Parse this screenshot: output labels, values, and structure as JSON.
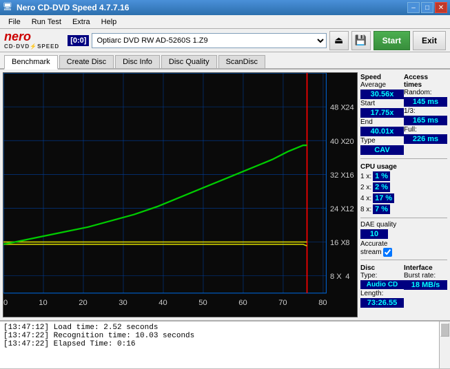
{
  "titlebar": {
    "icon": "●",
    "title": "Nero CD-DVD Speed 4.7.7.16",
    "minimize": "–",
    "maximize": "□",
    "close": "✕"
  },
  "menu": {
    "items": [
      "File",
      "Run Test",
      "Extra",
      "Help"
    ]
  },
  "toolbar": {
    "logo_nero": "nero",
    "logo_sub": "CD·DVD/SPEED",
    "drive_label": "[0:0]",
    "drive_value": "Optiarc DVD RW AD-5260S 1.Z9",
    "start_label": "Start",
    "exit_label": "Exit"
  },
  "tabs": {
    "items": [
      "Benchmark",
      "Create Disc",
      "Disc Info",
      "Disc Quality",
      "ScanDisc"
    ],
    "active": "Benchmark"
  },
  "stats": {
    "speed_label": "Speed",
    "average_label": "Average",
    "average_value": "30.56x",
    "start_label": "Start",
    "start_value": "17.75x",
    "end_label": "End",
    "end_value": "40.01x",
    "type_label": "Type",
    "type_value": "CAV",
    "access_times_label": "Access times",
    "random_label": "Random:",
    "random_value": "145 ms",
    "one_third_label": "1/3:",
    "one_third_value": "165 ms",
    "full_label": "Full:",
    "full_value": "226 ms",
    "cpu_label": "CPU usage",
    "cpu_1x_label": "1 x:",
    "cpu_1x_value": "1 %",
    "cpu_2x_label": "2 x:",
    "cpu_2x_value": "2 %",
    "cpu_4x_label": "4 x:",
    "cpu_4x_value": "17 %",
    "cpu_8x_label": "8 x:",
    "cpu_8x_value": "7 %",
    "dae_label": "DAE quality",
    "dae_value": "10",
    "accurate_label": "Accurate",
    "stream_label": "stream",
    "disc_label": "Disc",
    "disc_type_label": "Type:",
    "disc_type_value": "Audio CD",
    "disc_length_label": "Length:",
    "disc_length_value": "73:26.55",
    "interface_label": "Interface",
    "burst_label": "Burst rate:",
    "burst_value": "18 MB/s"
  },
  "log": {
    "lines": [
      "[13:47:12]  Load time: 2.52 seconds",
      "[13:47:22]  Recognition time: 10.03 seconds",
      "[13:47:22]  Elapsed Time: 0:16"
    ]
  },
  "chart": {
    "x_labels": [
      "0",
      "10",
      "20",
      "30",
      "40",
      "50",
      "60",
      "70",
      "80"
    ],
    "y_labels_left": [
      "8 X",
      "16 X",
      "24 X",
      "32 X",
      "40 X",
      "48 X"
    ],
    "y_labels_right": [
      "4",
      "8",
      "12",
      "16",
      "20",
      "24"
    ]
  }
}
